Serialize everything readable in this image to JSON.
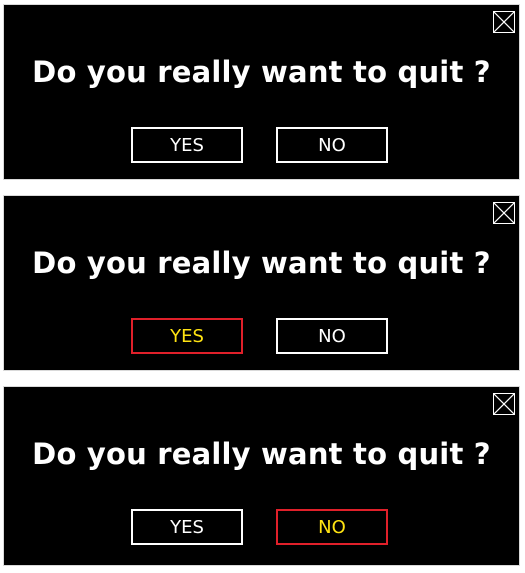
{
  "colors": {
    "background": "#000000",
    "text": "#ffffff",
    "highlight_border": "#e0202a",
    "highlight_text": "#ffe312"
  },
  "dialogs": [
    {
      "state": "none-selected",
      "question": "Do you really want to quit ?",
      "yes_label": "YES",
      "no_label": "NO",
      "close_icon": "close-icon"
    },
    {
      "state": "yes-hovered",
      "question": "Do you really want to quit ?",
      "yes_label": "YES",
      "no_label": "NO",
      "close_icon": "close-icon"
    },
    {
      "state": "no-hovered",
      "question": "Do you really want to quit ?",
      "yes_label": "YES",
      "no_label": "NO",
      "close_icon": "close-icon"
    }
  ]
}
